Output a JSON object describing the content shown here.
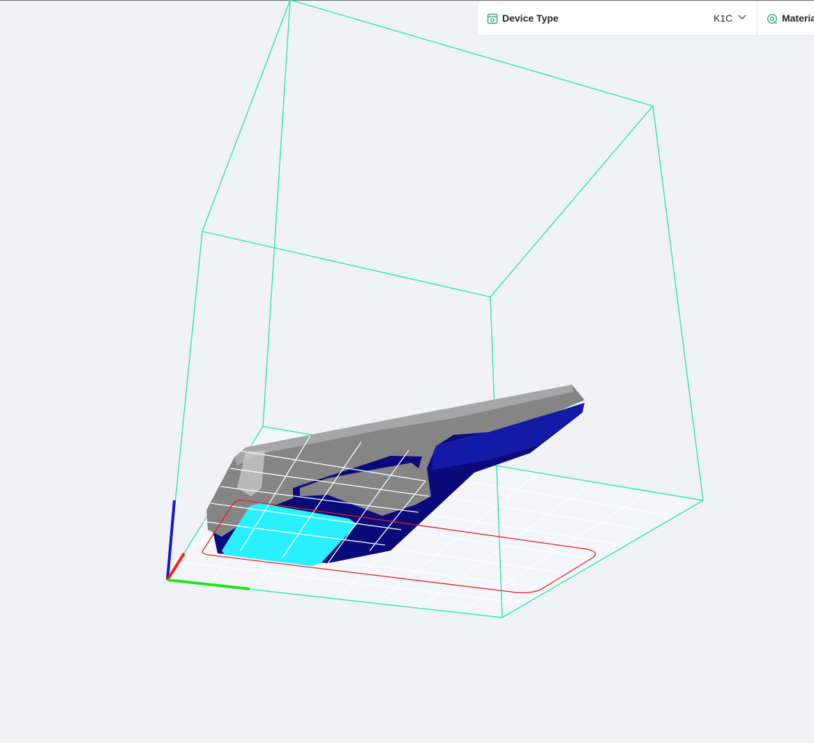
{
  "toolbar": {
    "device_type": {
      "icon": "printer-icon",
      "label": "Device Type",
      "value": "K1C"
    },
    "material": {
      "icon": "filament-spool-icon",
      "label": "Materia"
    }
  },
  "colors": {
    "background": "#f0f2f6",
    "build_volume": "#2ee6a8",
    "bed_outline": "#e02020",
    "axis_x": "#ff1a1a",
    "axis_y": "#1ee61e",
    "axis_z": "#1414d8",
    "model_gray": "#8a8a8a",
    "model_blue": "#0a0a7a",
    "selection_cyan": "#28f0ff",
    "accent": "#1fb76b"
  }
}
